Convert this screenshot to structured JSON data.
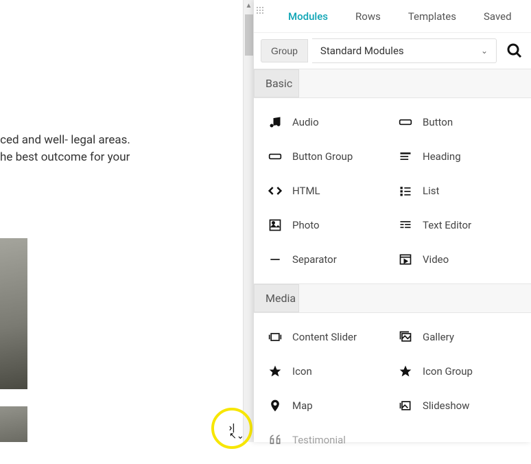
{
  "canvas": {
    "body_text": "nly experienced and well- legal areas. Trust in our he best outcome for your"
  },
  "panel": {
    "tabs": [
      {
        "label": "Modules",
        "active": true
      },
      {
        "label": "Rows",
        "active": false
      },
      {
        "label": "Templates",
        "active": false
      },
      {
        "label": "Saved",
        "active": false
      }
    ],
    "group_label": "Group",
    "group_value": "Standard Modules",
    "sections": [
      {
        "title": "Basic",
        "modules": [
          {
            "name": "audio",
            "label": "Audio",
            "icon": "music-icon"
          },
          {
            "name": "button",
            "label": "Button",
            "icon": "button-icon"
          },
          {
            "name": "button-group",
            "label": "Button Group",
            "icon": "button-group-icon"
          },
          {
            "name": "heading",
            "label": "Heading",
            "icon": "heading-icon"
          },
          {
            "name": "html",
            "label": "HTML",
            "icon": "code-icon"
          },
          {
            "name": "list",
            "label": "List",
            "icon": "list-icon"
          },
          {
            "name": "photo",
            "label": "Photo",
            "icon": "photo-icon"
          },
          {
            "name": "text-editor",
            "label": "Text Editor",
            "icon": "text-editor-icon"
          },
          {
            "name": "separator",
            "label": "Separator",
            "icon": "separator-icon"
          },
          {
            "name": "video",
            "label": "Video",
            "icon": "video-icon"
          }
        ]
      },
      {
        "title": "Media",
        "modules": [
          {
            "name": "content-slider",
            "label": "Content Slider",
            "icon": "slider-icon"
          },
          {
            "name": "gallery",
            "label": "Gallery",
            "icon": "gallery-icon"
          },
          {
            "name": "icon",
            "label": "Icon",
            "icon": "star-icon"
          },
          {
            "name": "icon-group",
            "label": "Icon Group",
            "icon": "star-icon"
          },
          {
            "name": "map",
            "label": "Map",
            "icon": "map-icon"
          },
          {
            "name": "slideshow",
            "label": "Slideshow",
            "icon": "slideshow-icon"
          },
          {
            "name": "testimonial",
            "label": "Testimonial",
            "icon": "quote-icon"
          }
        ]
      }
    ]
  }
}
